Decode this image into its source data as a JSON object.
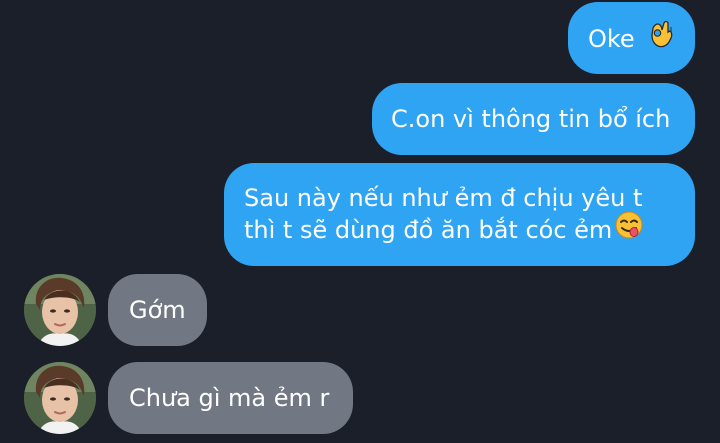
{
  "conversation": {
    "outgoing": [
      {
        "text": "Oke",
        "emoji": "ok-hand-emoji"
      },
      {
        "text": "C.on vì thông tin bổ ích"
      },
      {
        "line1": "Sau này nếu như ẻm đ chịu yêu t",
        "line2": "thì t sẽ dùng đồ ăn bắt cóc ẻm",
        "emoji": "face-savoring-food-emoji"
      }
    ],
    "incoming": [
      {
        "text": "Gớm",
        "avatar": "contact-avatar"
      },
      {
        "text": "Chưa gì mà ẻm r",
        "avatar": "contact-avatar"
      }
    ]
  },
  "colors": {
    "background": "#1b1f29",
    "outgoing_bubble": "#2fa4f3",
    "incoming_bubble": "#717883",
    "text": "#ffffff"
  }
}
